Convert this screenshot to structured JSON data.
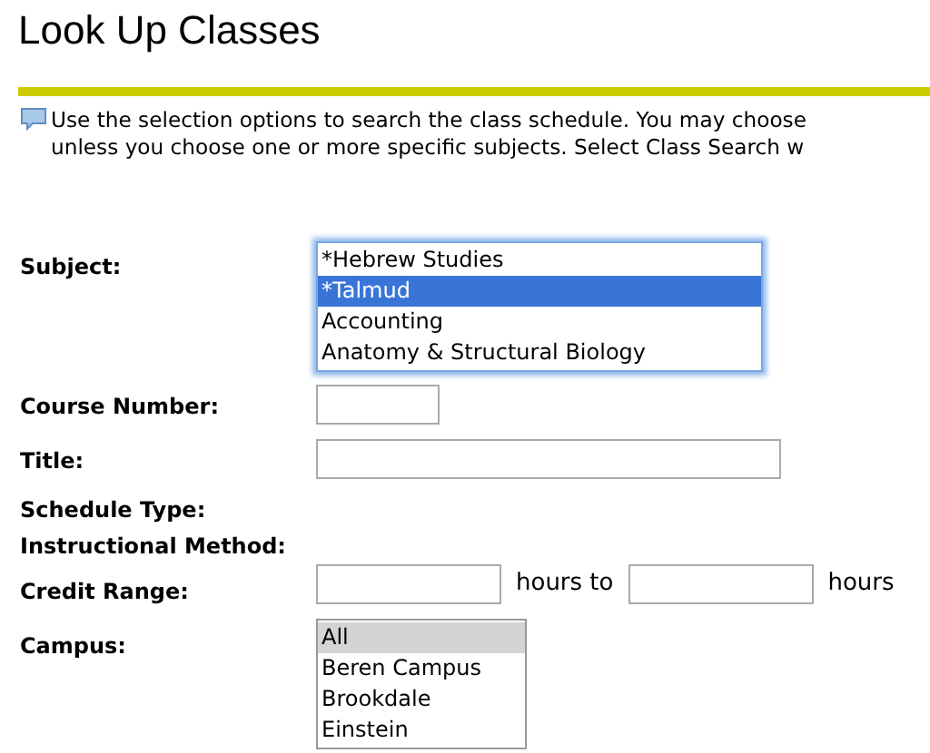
{
  "title": "Look Up Classes",
  "info": {
    "lines": [
      "Use the selection options to search the class schedule. You may choose",
      "unless you choose one or more specific subjects. Select Class Search w"
    ]
  },
  "form": {
    "subject": {
      "label": "Subject:",
      "focused": true,
      "options": [
        {
          "label": "*Hebrew Studies",
          "selected": false
        },
        {
          "label": "*Talmud",
          "selected": true
        },
        {
          "label": "Accounting",
          "selected": false
        },
        {
          "label": "Anatomy & Structural Biology",
          "selected": false
        }
      ]
    },
    "course_number": {
      "label": "Course Number:"
    },
    "title": {
      "label": "Title:"
    },
    "schedule_type": {
      "label": "Schedule Type:"
    },
    "instructional_method": {
      "label": "Instructional Method:"
    },
    "credit_range": {
      "label": "Credit Range:",
      "between": "hours to",
      "after": "hours"
    },
    "campus": {
      "label": "Campus:",
      "focused": false,
      "options": [
        {
          "label": "All",
          "selected": true
        },
        {
          "label": "Beren Campus",
          "selected": false
        },
        {
          "label": "Brookdale",
          "selected": false
        },
        {
          "label": "Einstein",
          "selected": false
        }
      ]
    }
  }
}
